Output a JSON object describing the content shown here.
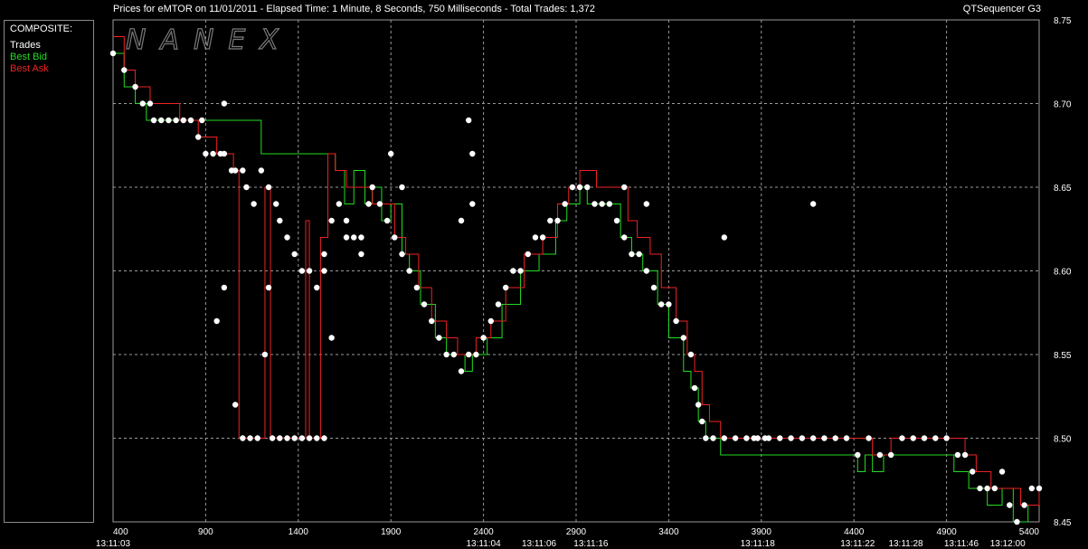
{
  "header": {
    "title": "Prices for  eMTOR  on  11/01/2011  -  Elapsed Time: 1 Minute, 8 Seconds, 750 Milliseconds  -  Total Trades: 1,372",
    "brand": "QTSequencer G3"
  },
  "legend": {
    "title": "COMPOSITE:",
    "items": [
      {
        "label": "Trades",
        "color": "#ffffff"
      },
      {
        "label": "Best Bid",
        "color": "#22dd22"
      },
      {
        "label": "Best Ask",
        "color": "#ee2222"
      }
    ]
  },
  "watermark": "NANEX",
  "chart_data": {
    "type": "scatter",
    "xlim": [
      400,
      5400
    ],
    "ylim": [
      8.45,
      8.75
    ],
    "y_ticks": [
      "8.45",
      "8.50",
      "8.55",
      "8.60",
      "8.65",
      "8.70",
      "8.75"
    ],
    "x_ticks": [
      "400",
      "900",
      "1400",
      "1900",
      "2400",
      "2900",
      "3400",
      "3900",
      "4400",
      "4900",
      "5400"
    ],
    "time_labels": [
      {
        "x": 400,
        "label": "13:11:03"
      },
      {
        "x": 2400,
        "label": "13:11:04"
      },
      {
        "x": 2700,
        "label": "13:11:06"
      },
      {
        "x": 2980,
        "label": "13:11:16"
      },
      {
        "x": 3880,
        "label": "13:11:18"
      },
      {
        "x": 4420,
        "label": "13:11:22"
      },
      {
        "x": 4680,
        "label": "13:11:28"
      },
      {
        "x": 4980,
        "label": "13:11:46"
      },
      {
        "x": 5230,
        "label": "13:12:00"
      }
    ],
    "grid": true,
    "colors": {
      "trades": "#ffffff",
      "bid": "#22dd22",
      "ask": "#ee2222",
      "grid": "#9a9a9a"
    },
    "series": [
      {
        "name": "Best Bid",
        "type": "step",
        "points": [
          [
            400,
            8.73
          ],
          [
            460,
            8.71
          ],
          [
            520,
            8.7
          ],
          [
            580,
            8.69
          ],
          [
            720,
            8.69
          ],
          [
            800,
            8.69
          ],
          [
            900,
            8.69
          ],
          [
            1000,
            8.69
          ],
          [
            1120,
            8.69
          ],
          [
            1200,
            8.67
          ],
          [
            1560,
            8.67
          ],
          [
            1600,
            8.66
          ],
          [
            1650,
            8.64
          ],
          [
            1700,
            8.66
          ],
          [
            1760,
            8.64
          ],
          [
            1800,
            8.65
          ],
          [
            1850,
            8.63
          ],
          [
            1900,
            8.64
          ],
          [
            1960,
            8.61
          ],
          [
            2000,
            8.6
          ],
          [
            2060,
            8.58
          ],
          [
            2140,
            8.56
          ],
          [
            2200,
            8.55
          ],
          [
            2300,
            8.54
          ],
          [
            2340,
            8.55
          ],
          [
            2420,
            8.56
          ],
          [
            2500,
            8.58
          ],
          [
            2600,
            8.6
          ],
          [
            2700,
            8.61
          ],
          [
            2790,
            8.63
          ],
          [
            2850,
            8.64
          ],
          [
            2920,
            8.65
          ],
          [
            2960,
            8.64
          ],
          [
            3000,
            8.64
          ],
          [
            3100,
            8.64
          ],
          [
            3140,
            8.62
          ],
          [
            3200,
            8.61
          ],
          [
            3260,
            8.6
          ],
          [
            3340,
            8.58
          ],
          [
            3400,
            8.56
          ],
          [
            3480,
            8.54
          ],
          [
            3520,
            8.53
          ],
          [
            3560,
            8.51
          ],
          [
            3600,
            8.5
          ],
          [
            3680,
            8.49
          ],
          [
            4380,
            8.49
          ],
          [
            4420,
            8.48
          ],
          [
            4460,
            8.49
          ],
          [
            4500,
            8.48
          ],
          [
            4560,
            8.49
          ],
          [
            4900,
            8.49
          ],
          [
            4940,
            8.48
          ],
          [
            5020,
            8.47
          ],
          [
            5120,
            8.46
          ],
          [
            5200,
            8.47
          ],
          [
            5260,
            8.45
          ],
          [
            5340,
            8.46
          ],
          [
            5400,
            8.46
          ]
        ]
      },
      {
        "name": "Best Ask",
        "type": "step",
        "points": [
          [
            400,
            8.74
          ],
          [
            460,
            8.72
          ],
          [
            520,
            8.71
          ],
          [
            600,
            8.7
          ],
          [
            760,
            8.69
          ],
          [
            860,
            8.68
          ],
          [
            960,
            8.67
          ],
          [
            1050,
            8.66
          ],
          [
            1080,
            8.5
          ],
          [
            1200,
            8.5
          ],
          [
            1220,
            8.65
          ],
          [
            1250,
            8.5
          ],
          [
            1420,
            8.5
          ],
          [
            1440,
            8.63
          ],
          [
            1460,
            8.5
          ],
          [
            1500,
            8.5
          ],
          [
            1520,
            8.62
          ],
          [
            1560,
            8.67
          ],
          [
            1600,
            8.66
          ],
          [
            1660,
            8.65
          ],
          [
            1760,
            8.65
          ],
          [
            1800,
            8.64
          ],
          [
            1860,
            8.64
          ],
          [
            1920,
            8.62
          ],
          [
            1980,
            8.61
          ],
          [
            2050,
            8.59
          ],
          [
            2120,
            8.57
          ],
          [
            2200,
            8.56
          ],
          [
            2260,
            8.55
          ],
          [
            2360,
            8.56
          ],
          [
            2440,
            8.57
          ],
          [
            2520,
            8.59
          ],
          [
            2620,
            8.61
          ],
          [
            2720,
            8.62
          ],
          [
            2800,
            8.64
          ],
          [
            2860,
            8.65
          ],
          [
            2920,
            8.66
          ],
          [
            3000,
            8.66
          ],
          [
            3010,
            8.65
          ],
          [
            3100,
            8.65
          ],
          [
            3180,
            8.63
          ],
          [
            3230,
            8.62
          ],
          [
            3300,
            8.61
          ],
          [
            3360,
            8.59
          ],
          [
            3440,
            8.57
          ],
          [
            3500,
            8.55
          ],
          [
            3540,
            8.54
          ],
          [
            3580,
            8.52
          ],
          [
            3620,
            8.51
          ],
          [
            3680,
            8.5
          ],
          [
            4400,
            8.5
          ],
          [
            4500,
            8.49
          ],
          [
            4600,
            8.5
          ],
          [
            4960,
            8.5
          ],
          [
            5000,
            8.49
          ],
          [
            5060,
            8.48
          ],
          [
            5140,
            8.47
          ],
          [
            5220,
            8.47
          ],
          [
            5300,
            8.46
          ],
          [
            5400,
            8.47
          ]
        ]
      },
      {
        "name": "Trades",
        "type": "scatter",
        "points": [
          [
            400,
            8.73
          ],
          [
            460,
            8.72
          ],
          [
            520,
            8.71
          ],
          [
            560,
            8.7
          ],
          [
            600,
            8.7
          ],
          [
            620,
            8.69
          ],
          [
            660,
            8.69
          ],
          [
            700,
            8.69
          ],
          [
            740,
            8.69
          ],
          [
            780,
            8.69
          ],
          [
            820,
            8.69
          ],
          [
            860,
            8.68
          ],
          [
            880,
            8.69
          ],
          [
            900,
            8.67
          ],
          [
            940,
            8.67
          ],
          [
            980,
            8.67
          ],
          [
            1000,
            8.67
          ],
          [
            1040,
            8.66
          ],
          [
            1060,
            8.66
          ],
          [
            1100,
            8.66
          ],
          [
            1120,
            8.65
          ],
          [
            1160,
            8.64
          ],
          [
            1200,
            8.66
          ],
          [
            1240,
            8.65
          ],
          [
            1280,
            8.64
          ],
          [
            1300,
            8.63
          ],
          [
            1340,
            8.62
          ],
          [
            1380,
            8.61
          ],
          [
            1420,
            8.6
          ],
          [
            1460,
            8.6
          ],
          [
            1500,
            8.59
          ],
          [
            1540,
            8.6
          ],
          [
            1580,
            8.63
          ],
          [
            1620,
            8.64
          ],
          [
            1660,
            8.63
          ],
          [
            1700,
            8.62
          ],
          [
            1740,
            8.61
          ],
          [
            1780,
            8.64
          ],
          [
            1800,
            8.65
          ],
          [
            1840,
            8.64
          ],
          [
            1880,
            8.63
          ],
          [
            1920,
            8.62
          ],
          [
            1960,
            8.61
          ],
          [
            2000,
            8.6
          ],
          [
            2040,
            8.59
          ],
          [
            2080,
            8.58
          ],
          [
            2120,
            8.57
          ],
          [
            2160,
            8.56
          ],
          [
            2200,
            8.55
          ],
          [
            2240,
            8.55
          ],
          [
            2280,
            8.54
          ],
          [
            2320,
            8.55
          ],
          [
            2360,
            8.55
          ],
          [
            2400,
            8.56
          ],
          [
            2440,
            8.57
          ],
          [
            2480,
            8.58
          ],
          [
            2520,
            8.59
          ],
          [
            2560,
            8.6
          ],
          [
            2600,
            8.6
          ],
          [
            2640,
            8.61
          ],
          [
            2680,
            8.62
          ],
          [
            2720,
            8.62
          ],
          [
            2760,
            8.63
          ],
          [
            2800,
            8.63
          ],
          [
            2840,
            8.64
          ],
          [
            2880,
            8.65
          ],
          [
            2920,
            8.65
          ],
          [
            2960,
            8.65
          ],
          [
            3000,
            8.64
          ],
          [
            3040,
            8.64
          ],
          [
            3080,
            8.64
          ],
          [
            3120,
            8.63
          ],
          [
            3160,
            8.62
          ],
          [
            3200,
            8.61
          ],
          [
            3240,
            8.61
          ],
          [
            3280,
            8.6
          ],
          [
            3320,
            8.59
          ],
          [
            3360,
            8.58
          ],
          [
            3400,
            8.58
          ],
          [
            3440,
            8.57
          ],
          [
            3480,
            8.56
          ],
          [
            3520,
            8.55
          ],
          [
            3540,
            8.53
          ],
          [
            3560,
            8.52
          ],
          [
            3580,
            8.51
          ],
          [
            3600,
            8.5
          ],
          [
            3640,
            8.5
          ],
          [
            3700,
            8.5
          ],
          [
            3760,
            8.5
          ],
          [
            3820,
            8.5
          ],
          [
            3880,
            8.5
          ],
          [
            3940,
            8.5
          ],
          [
            4000,
            8.5
          ],
          [
            4060,
            8.5
          ],
          [
            4120,
            8.5
          ],
          [
            4180,
            8.5
          ],
          [
            4240,
            8.5
          ],
          [
            4300,
            8.5
          ],
          [
            4360,
            8.5
          ],
          [
            4420,
            8.49
          ],
          [
            4480,
            8.5
          ],
          [
            4540,
            8.49
          ],
          [
            4600,
            8.49
          ],
          [
            4660,
            8.5
          ],
          [
            4720,
            8.5
          ],
          [
            4780,
            8.5
          ],
          [
            4840,
            8.5
          ],
          [
            4900,
            8.5
          ],
          [
            4960,
            8.49
          ],
          [
            5000,
            8.49
          ],
          [
            5040,
            8.48
          ],
          [
            5080,
            8.47
          ],
          [
            5120,
            8.47
          ],
          [
            5160,
            8.47
          ],
          [
            5200,
            8.48
          ],
          [
            5240,
            8.46
          ],
          [
            5280,
            8.45
          ],
          [
            5320,
            8.46
          ],
          [
            5360,
            8.47
          ],
          [
            5400,
            8.47
          ],
          [
            1060,
            8.52
          ],
          [
            1100,
            8.5
          ],
          [
            1140,
            8.5
          ],
          [
            1180,
            8.5
          ],
          [
            1220,
            8.55
          ],
          [
            1260,
            8.5
          ],
          [
            1300,
            8.5
          ],
          [
            1340,
            8.5
          ],
          [
            1380,
            8.5
          ],
          [
            1420,
            8.5
          ],
          [
            1460,
            8.5
          ],
          [
            1500,
            8.5
          ],
          [
            1540,
            8.5
          ],
          [
            960,
            8.57
          ],
          [
            1000,
            8.59
          ],
          [
            1240,
            8.59
          ],
          [
            1580,
            8.56
          ],
          [
            1000,
            8.7
          ],
          [
            2320,
            8.69
          ],
          [
            2340,
            8.67
          ],
          [
            2340,
            8.64
          ],
          [
            2280,
            8.63
          ],
          [
            3700,
            8.62
          ],
          [
            4180,
            8.64
          ],
          [
            1900,
            8.67
          ],
          [
            1540,
            8.61
          ],
          [
            3160,
            8.65
          ],
          [
            3280,
            8.64
          ],
          [
            3860,
            8.5
          ],
          [
            3920,
            8.5
          ],
          [
            1660,
            8.62
          ],
          [
            1740,
            8.62
          ],
          [
            1960,
            8.65
          ]
        ]
      }
    ]
  }
}
